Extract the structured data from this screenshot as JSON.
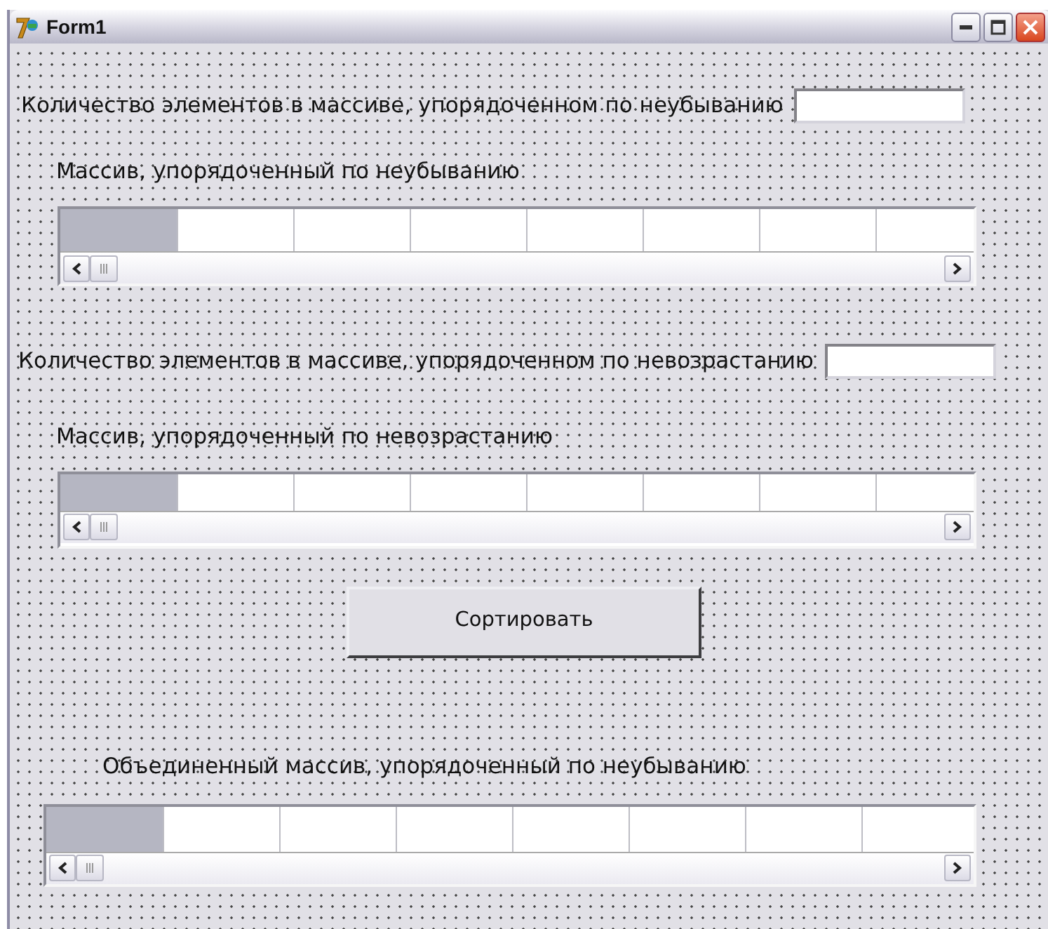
{
  "window": {
    "title": "Form1"
  },
  "form": [
    {
      "kind": "count",
      "label": "Количество элементов в массиве, упорядоченном по неубыванию"
    },
    {
      "kind": "caption",
      "text": "Массив, упорядоченный по неубыванию"
    },
    {
      "kind": "grid"
    },
    {
      "kind": "count",
      "label": "Количество элементов в массиве, упорядоченном по невозрастанию"
    },
    {
      "kind": "caption",
      "text": "Массив, упорядоченный по невозрастанию"
    },
    {
      "kind": "grid"
    },
    {
      "kind": "button",
      "label": "Сортировать"
    },
    {
      "kind": "caption",
      "text": "Объединенный массив, упорядоченный по неубыванию"
    },
    {
      "kind": "grid"
    }
  ]
}
